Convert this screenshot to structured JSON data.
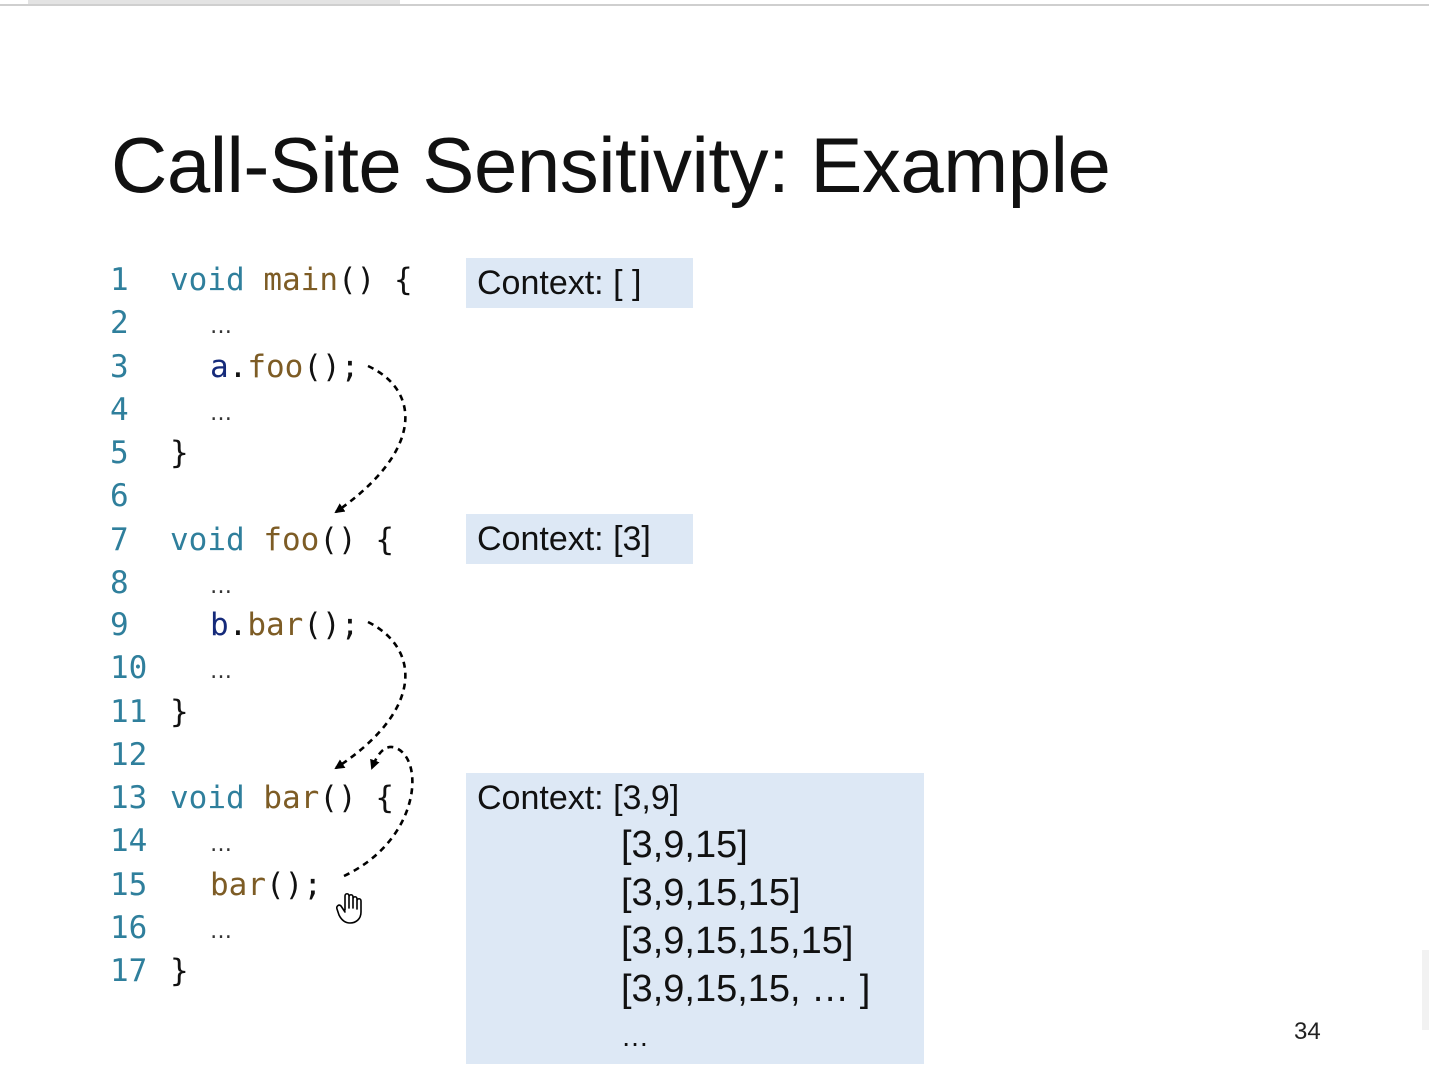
{
  "slide": {
    "title": "Call-Site Sensitivity: Example",
    "page_number": "34",
    "colors": {
      "keyword": "#2f7f9c",
      "function": "#7d5c25",
      "object": "#152a7a",
      "context_box": "#dde8f5"
    }
  },
  "code": {
    "lines": [
      {
        "n": "1",
        "kw": "void ",
        "fn": "main",
        "pn": "() {"
      },
      {
        "n": "2",
        "ellipsis": "…"
      },
      {
        "n": "3",
        "obj": "a",
        "pn_dot": ".",
        "fn": "foo",
        "pn": "();"
      },
      {
        "n": "4",
        "ellipsis": "…"
      },
      {
        "n": "5",
        "pn": "}"
      },
      {
        "n": "6"
      },
      {
        "n": "7",
        "kw": "void ",
        "fn": "foo",
        "pn": "() {"
      },
      {
        "n": "8",
        "ellipsis": "…"
      },
      {
        "n": "9",
        "obj": "b",
        "pn_dot": ".",
        "fn": "bar",
        "pn": "();"
      },
      {
        "n": "10",
        "ellipsis": "…"
      },
      {
        "n": "11",
        "pn": "}"
      },
      {
        "n": "12"
      },
      {
        "n": "13",
        "kw": "void ",
        "fn": "bar",
        "pn": "() {"
      },
      {
        "n": "14",
        "ellipsis": "…"
      },
      {
        "n": "15",
        "fn": "bar",
        "pn": "();"
      },
      {
        "n": "16",
        "ellipsis": "…"
      },
      {
        "n": "17",
        "pn": "}"
      }
    ]
  },
  "contexts": {
    "main": {
      "label": "Context: [ ]"
    },
    "foo": {
      "label": "Context: [3]"
    },
    "bar": {
      "label": "Context: [3,9]",
      "entries": [
        "[3,9,15]",
        "[3,9,15,15]",
        "[3,9,15,15,15]",
        "[3,9,15,15, … ]",
        "…"
      ]
    }
  },
  "icons": {
    "cursor": "hand-cursor-icon"
  }
}
